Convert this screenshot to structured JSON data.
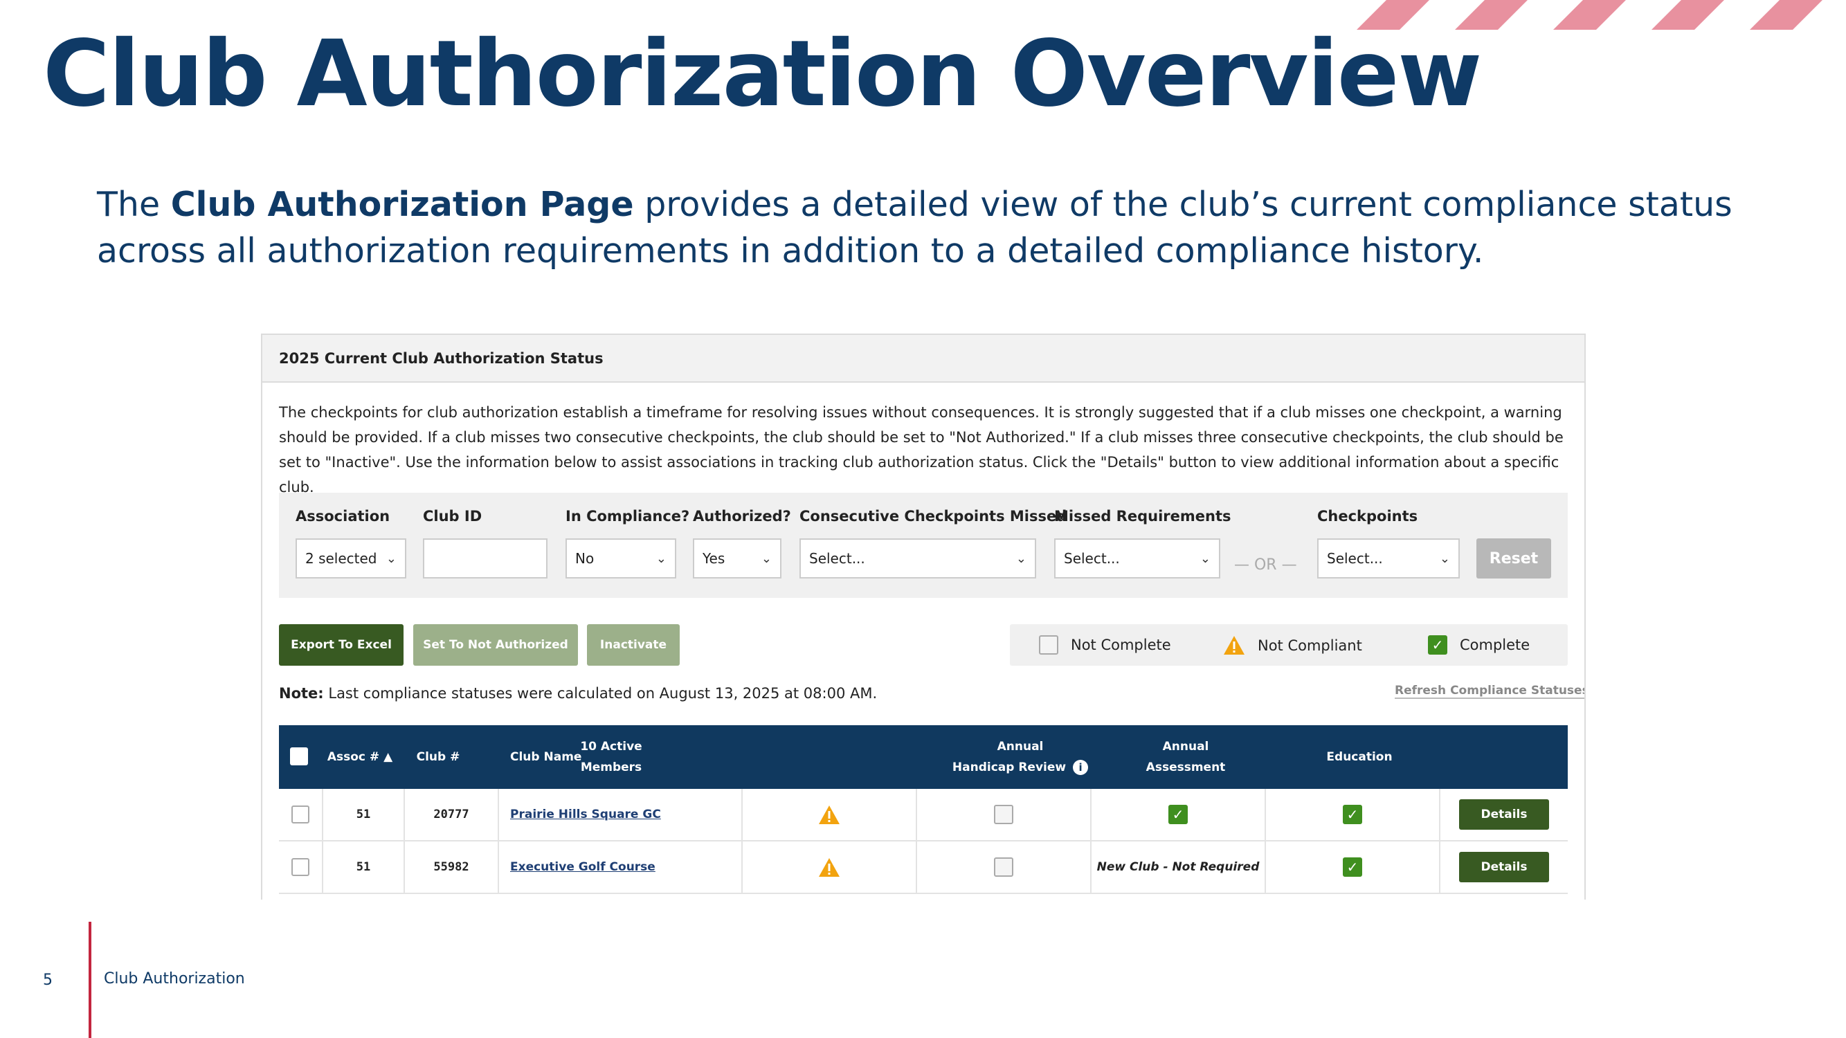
{
  "slide": {
    "title": "Club Authorization Overview",
    "intro_pre": "The ",
    "intro_bold": "Club Authorization Page",
    "intro_post": " provides a detailed view of the club’s current compliance status across all authorization requirements in addition to a detailed compliance history.",
    "footer_page": "5",
    "footer_label": "Club Authorization",
    "accent_color": "#0f3a66",
    "stripe_color": "#e8919f",
    "footer_line_color": "#c3263f"
  },
  "panel": {
    "header": "2025 Current Club Authorization Status",
    "description": "The checkpoints for club authorization establish a timeframe for resolving issues without consequences. It is strongly suggested that if a club misses one checkpoint, a warning should be provided. If a club misses two consecutive checkpoints, the club should be set to \"Not Authorized.\" If a club misses three consecutive checkpoints, the club should be set to \"Inactive\". Use the information below to assist associations in tracking club authorization status. Click the \"Details\" button to view additional information about a specific club."
  },
  "filters": {
    "association": {
      "label": "Association",
      "value": "2 selected"
    },
    "club_id": {
      "label": "Club ID",
      "value": ""
    },
    "in_compliance": {
      "label": "In Compliance?",
      "value": "No"
    },
    "authorized": {
      "label": "Authorized?",
      "value": "Yes"
    },
    "consecutive": {
      "label": "Consecutive Checkpoints Missed",
      "value": "Select..."
    },
    "missed": {
      "label": "Missed Requirements",
      "value": "Select..."
    },
    "or_text": "— OR —",
    "checkpoints": {
      "label": "Checkpoints",
      "value": "Select..."
    },
    "reset_label": "Reset"
  },
  "actions": {
    "export": "Export To Excel",
    "set_not_authorized": "Set To Not Authorized",
    "inactivate": "Inactivate",
    "export_color": "#385a22",
    "disabled_color": "#9cb08a"
  },
  "legend": {
    "not_complete": "Not Complete",
    "not_compliant": "Not Compliant",
    "complete": "Complete",
    "not_complete_icon": "empty-checkbox-icon",
    "not_compliant_icon": "warning-triangle-icon",
    "complete_icon": "green-check-icon"
  },
  "note": {
    "prefix": "Note:",
    "text": " Last compliance statuses were calculated on August 13, 2025 at 08:00 AM.",
    "refresh_link": "Refresh Compliance Statuses"
  },
  "table": {
    "headers": {
      "assoc": "Assoc # ▲",
      "club": "Club #",
      "name": "Club Name",
      "active_1": "10 Active",
      "active_2": "Members",
      "handicap_1": "Annual",
      "handicap_2": "Handicap Review",
      "assessment_1": "Annual",
      "assessment_2": "Assessment",
      "education": "Education"
    },
    "rows": [
      {
        "assoc": "51",
        "club": "20777",
        "name": "Prairie Hills Square GC",
        "active": "warning",
        "handicap": "empty",
        "assessment": "check",
        "assessment_text": "",
        "education": "check",
        "details": "Details"
      },
      {
        "assoc": "51",
        "club": "55982",
        "name": "Executive Golf Course",
        "active": "warning",
        "handicap": "empty",
        "assessment": "text",
        "assessment_text": "New Club - Not Required",
        "education": "check",
        "details": "Details"
      }
    ]
  }
}
